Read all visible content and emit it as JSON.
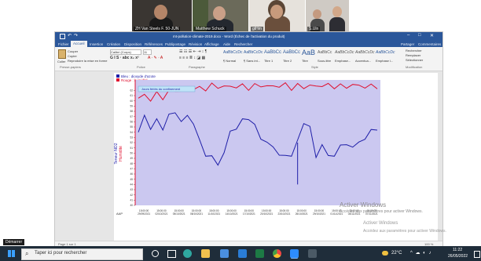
{
  "video_tiles": [
    {
      "name": "ZH Van Steels F. 50-JUN"
    },
    {
      "name": "Matthew Schuck"
    },
    {
      "name": "gtHm"
    },
    {
      "name": "S.Uln"
    }
  ],
  "word": {
    "title": "mt-pollution-climate-2019.docx - Word (Échec de l'activation du produit)",
    "tabs": [
      "Fichier",
      "Accueil",
      "Insertion",
      "Création",
      "Disposition",
      "Références",
      "Publipostage",
      "Révision",
      "Affichage",
      "Aide",
      "Rechercher"
    ],
    "active_tab": "Accueil",
    "right_actions": [
      "Partager",
      "Commentaires"
    ],
    "clipboard": {
      "paste": "Coller",
      "cut": "Couper",
      "copy": "Copier",
      "format_painter": "Reproduire la mise en forme"
    },
    "font_name": "Calibri (Corps)",
    "font_size": "11",
    "styles": [
      "AaBbCcDc",
      "AaBbCcDc",
      "AaBbCc",
      "AaBbCc",
      "AaB",
      "AaBbCc",
      "AaBbCcDc",
      "AaBbCcDc",
      "AaBbCcDc"
    ],
    "style_names": [
      "¶ Normal",
      "¶ Sans int...",
      "Titre 1",
      "Titre 2",
      "Titre",
      "Sous-titre",
      "Emphase...",
      "Accentua...",
      "Emphase i..."
    ],
    "editing": [
      "Rechercher",
      "Remplacer",
      "Sélectionner"
    ],
    "group_labels": [
      "Presse-papiers",
      "Police",
      "Paragraphe",
      "Style",
      "Modification"
    ],
    "status_left": "Page 1 sur 1",
    "status_right": "100 %"
  },
  "chart_data": {
    "type": "line",
    "title": "",
    "legend": [
      {
        "name": "Bleu : dioxyde d'azote",
        "color": "#1f1fa8"
      },
      {
        "name": "Rouge : humidité",
        "color": "#e0102f"
      }
    ],
    "annotation": "Jours fériés du confinement",
    "ylabel_blue": "Teneur NO2",
    "ylabel_red": "Humidité",
    "y_ticks": [
      "62",
      "61",
      "60",
      "59",
      "58",
      "57",
      "56",
      "55",
      "54",
      "53",
      "52",
      "51",
      "50",
      "49",
      "48",
      "47",
      "46",
      "45",
      "44",
      "43",
      "42",
      "41",
      "40"
    ],
    "x_ticks": [
      "15:00:00 29/09/2021",
      "15:00:00 02/10/2021",
      "15:00:00 05/10/2021",
      "15:00:00 08/10/2021",
      "15:00:00 11/10/2021",
      "15:00:00 14/10/2021",
      "15:00:00 17/10/2021",
      "15:00:00 20/10/2021",
      "15:00:00 23/10/2021",
      "15:00:00 26/10/2021",
      "15:00:00 29/10/2021",
      "15:00:00 01/11/2021",
      "15:00:00 04/11/2021",
      "15:00:00 07/11/2021"
    ],
    "x_axis_unit": "AAP",
    "grid": false,
    "series": [
      {
        "name": "Rouge : humidité",
        "color": "#e0102f",
        "values": [
          60.5,
          61.0,
          60.4,
          61.2,
          60.8,
          61.6,
          62.1,
          61.8,
          62.4,
          62.6,
          62.2,
          62.5,
          62.9,
          62.7,
          62.8,
          62.6,
          62.9,
          62.7,
          62.6,
          62.8,
          63.0,
          62.8,
          62.7,
          63.0,
          62.9,
          62.6,
          62.8,
          62.7,
          62.9,
          62.7,
          63.1,
          62.8,
          62.9,
          62.7,
          62.8,
          63.0,
          62.9,
          62.8,
          62.7,
          62.9
        ]
      },
      {
        "name": "Bleu : dioxyde d'azote",
        "color": "#1f1fa8",
        "values": [
          54,
          57,
          55,
          56,
          55,
          57,
          58,
          56,
          57,
          56,
          52,
          50,
          49,
          48,
          50,
          54,
          55,
          56,
          57,
          55,
          53,
          52,
          51,
          50,
          49,
          50,
          52,
          56,
          55,
          49,
          52,
          49,
          50,
          51,
          52,
          51,
          52,
          53,
          54,
          55
        ]
      }
    ],
    "extra_points": {
      "blue_spike_index": 26,
      "blue_spike_low": 44
    }
  },
  "watermark": {
    "title": "Activer Windows",
    "subtitle": "Accédez aux paramètres pour activer Windows."
  },
  "taskbar": {
    "search_placeholder": "Taper ici pour rechercher",
    "start_tooltip": "Démarrer",
    "temperature": "22°C",
    "time": "11:22",
    "date": "26/05/2022"
  }
}
